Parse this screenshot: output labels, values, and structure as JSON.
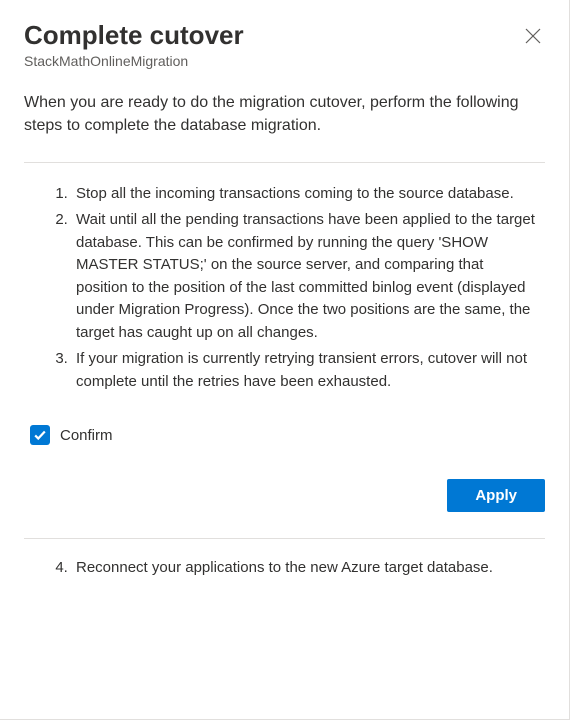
{
  "header": {
    "title": "Complete cutover",
    "subtitle": "StackMathOnlineMigration"
  },
  "intro": "When you are ready to do the migration cutover, perform the following steps to complete the database migration.",
  "steps_top": [
    "Stop all the incoming transactions coming to the source database.",
    "Wait until all the pending transactions have been applied to the target database. This can be confirmed by running the query 'SHOW MASTER STATUS;' on the source server, and comparing that position to the position of the last committed binlog event (displayed under Migration Progress). Once the two positions are the same, the target has caught up on all changes.",
    "If your migration is currently retrying transient errors, cutover will not complete until the retries have been exhausted."
  ],
  "confirm": {
    "label": "Confirm",
    "checked": true
  },
  "actions": {
    "apply_label": "Apply"
  },
  "steps_bottom": [
    "Reconnect your applications to the new Azure target database."
  ]
}
